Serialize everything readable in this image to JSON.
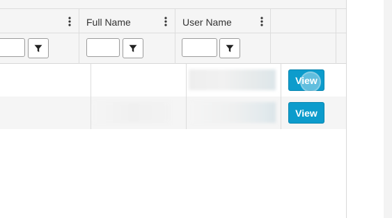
{
  "grid": {
    "columns": [
      {
        "key": "col-prev",
        "title": ""
      },
      {
        "key": "full-name",
        "title": "Full Name"
      },
      {
        "key": "user-name",
        "title": "User Name"
      },
      {
        "key": "actions",
        "title": ""
      }
    ],
    "filters": {
      "col_prev": "",
      "full_name": "",
      "user_name": ""
    },
    "rows": [
      {
        "full_name": "",
        "user_name": "",
        "action_label": "View"
      },
      {
        "full_name": "",
        "user_name": "",
        "action_label": "View"
      }
    ]
  },
  "icons": {
    "column_menu": "vertical-ellipsis-icon",
    "filter": "funnel-filter-icon"
  },
  "colors": {
    "view_button": "#0d9ccc",
    "header_bg": "#f5f5f5",
    "row_alt_bg": "#f5f5f5"
  }
}
